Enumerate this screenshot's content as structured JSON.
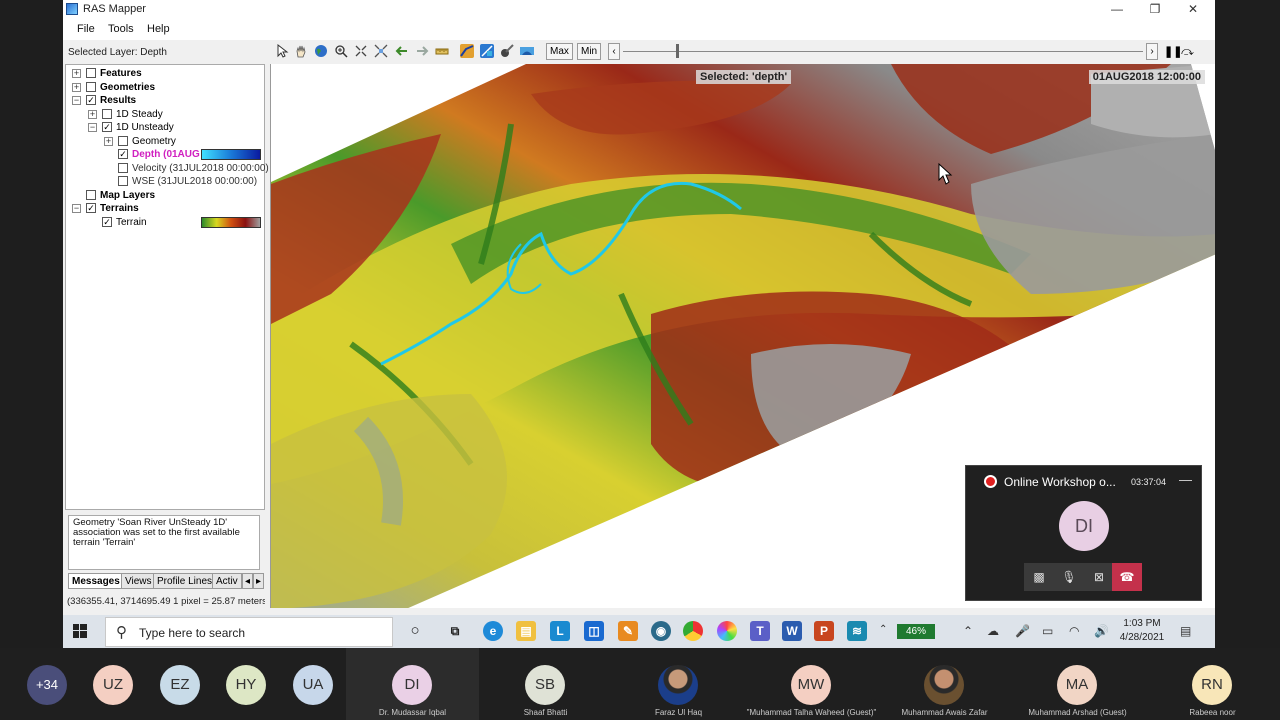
{
  "window": {
    "title": "RAS Mapper",
    "minimize": "—",
    "maximize": "❐",
    "close": "✕"
  },
  "menu": [
    "File",
    "Tools",
    "Help"
  ],
  "toolbar": {
    "selected_layer": "Selected Layer: Depth",
    "max_label": "Max",
    "min_label": "Min"
  },
  "tree": {
    "features": "Features",
    "geometries": "Geometries",
    "results": "Results",
    "steady": "1D Steady",
    "unsteady": "1D Unsteady",
    "geometry": "Geometry",
    "depth": "Depth (01AUG",
    "velocity": "Velocity (31JUL2018 00:00:00)",
    "wse": "WSE (31JUL2018 00:00:00)",
    "map_layers": "Map Layers",
    "terrains": "Terrains",
    "terrain": "Terrain"
  },
  "messages": {
    "text": "Geometry 'Soan River UnSteady 1D' association was set to the first available terrain 'Terrain'"
  },
  "tabs": [
    "Messages",
    "Views",
    "Profile Lines",
    "Activ"
  ],
  "coords": "(336355.41, 3714695.49  1 pixel = 25.87 meters)",
  "map": {
    "selected_label": "Selected: 'depth'",
    "time_label": "01AUG2018 12:00:00"
  },
  "meeting": {
    "title": "Online Workshop o...",
    "duration": "03:37:04",
    "minimize": "—",
    "avatar_initials": "DI"
  },
  "taskbar": {
    "search_placeholder": "Type here to search",
    "battery": "46%",
    "time": "1:03 PM",
    "date": "4/28/2021"
  },
  "participants": [
    {
      "initials": "+34",
      "name": "",
      "color": "#4a4e7a"
    },
    {
      "initials": "UZ",
      "name": "",
      "color": "#f4cfc2"
    },
    {
      "initials": "EZ",
      "name": "",
      "color": "#c8dbe8"
    },
    {
      "initials": "HY",
      "name": "",
      "color": "#dde7c5"
    },
    {
      "initials": "UA",
      "name": "",
      "color": "#c7d7ea"
    },
    {
      "initials": "DI",
      "name": "Dr. Mudassar Iqbal",
      "color": "#ead0e6"
    },
    {
      "initials": "SB",
      "name": "Shaaf Bhatti",
      "color": "#dfe2d6"
    },
    {
      "initials": "",
      "name": "Faraz Ul Haq",
      "color": ""
    },
    {
      "initials": "MW",
      "name": "\"Muhammad Talha Waheed (Guest)\"",
      "color": "#f4cfc2"
    },
    {
      "initials": "",
      "name": "Muhammad Awais Zafar",
      "color": ""
    },
    {
      "initials": "MA",
      "name": "Muhammad Arshad (Guest)",
      "color": "#f1d5c5"
    },
    {
      "initials": "RN",
      "name": "Rabeea noor",
      "color": "#f8e6b8"
    }
  ]
}
